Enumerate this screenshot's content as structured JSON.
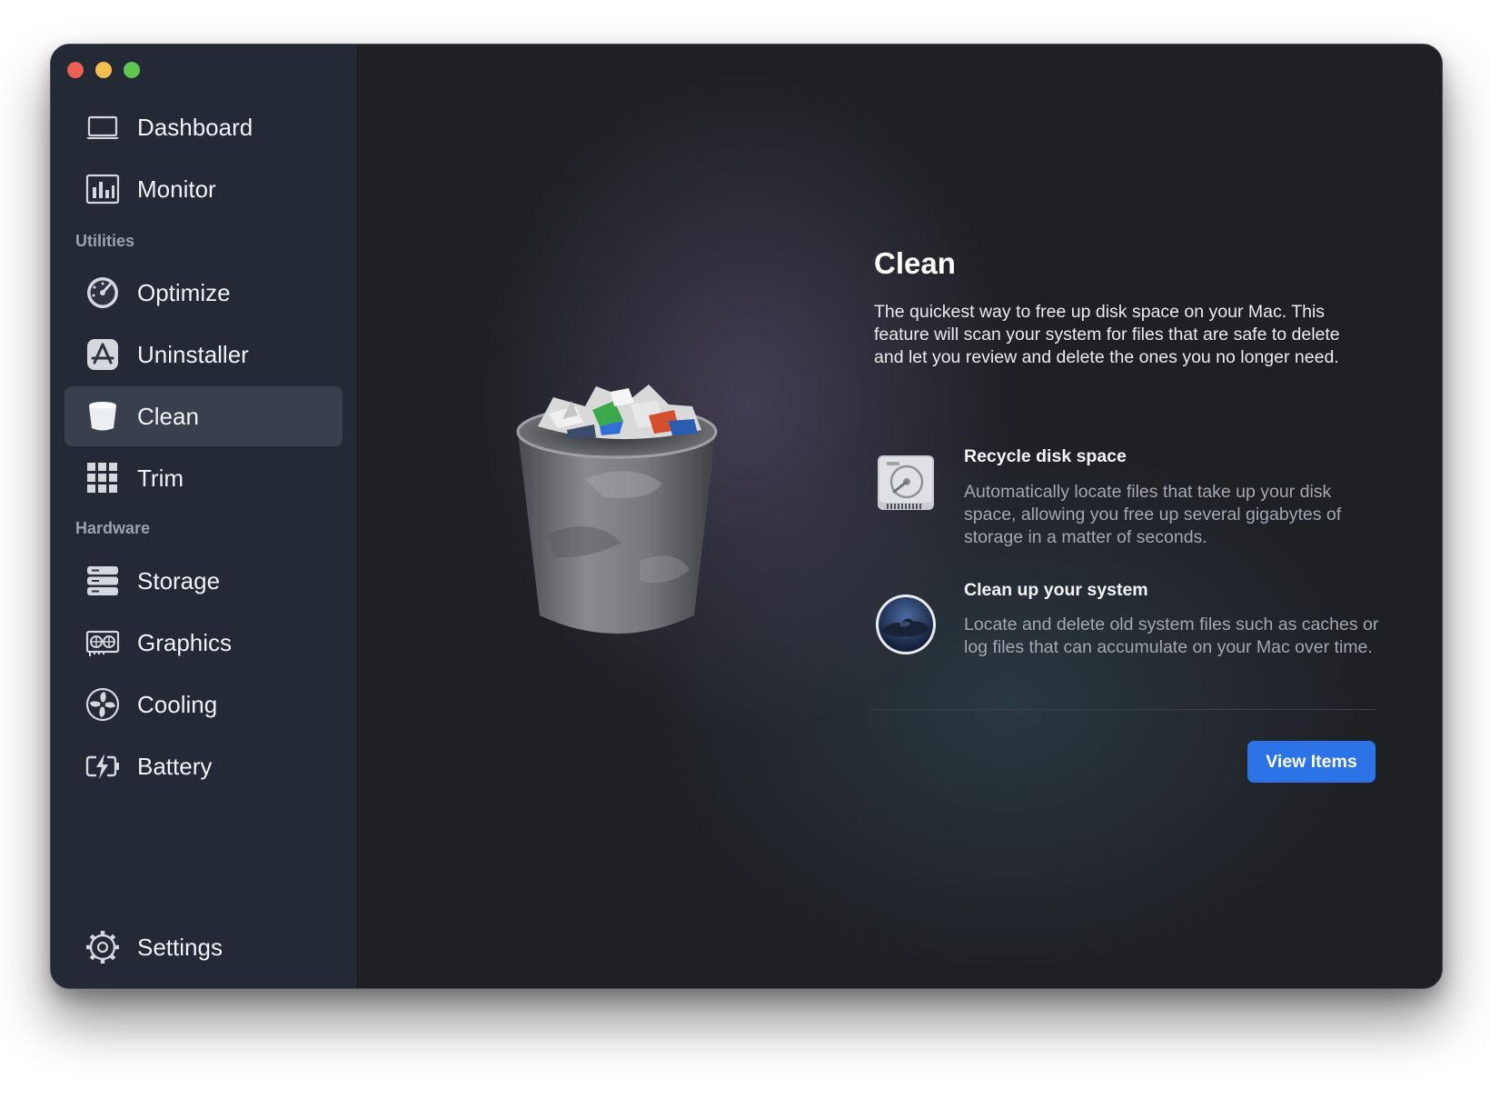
{
  "sidebar": {
    "top_items": [
      {
        "label": "Dashboard",
        "icon": "laptop-icon"
      },
      {
        "label": "Monitor",
        "icon": "bar-chart-icon"
      }
    ],
    "sections": [
      {
        "title": "Utilities",
        "items": [
          {
            "label": "Optimize",
            "icon": "speedometer-icon"
          },
          {
            "label": "Uninstaller",
            "icon": "app-store-icon"
          },
          {
            "label": "Clean",
            "icon": "cup-icon",
            "active": true
          },
          {
            "label": "Trim",
            "icon": "grid-icon"
          }
        ]
      },
      {
        "title": "Hardware",
        "items": [
          {
            "label": "Storage",
            "icon": "storage-icon"
          },
          {
            "label": "Graphics",
            "icon": "graphics-card-icon"
          },
          {
            "label": "Cooling",
            "icon": "fan-icon"
          },
          {
            "label": "Battery",
            "icon": "battery-icon"
          }
        ]
      }
    ],
    "settings": {
      "label": "Settings",
      "icon": "gear-icon"
    }
  },
  "main": {
    "title": "Clean",
    "description": "The quickest way to free up disk space on your Mac. This feature will scan your system for files that are safe to delete and let you review and delete the ones you no longer need.",
    "features": [
      {
        "title": "Recycle disk space",
        "description": "Automatically locate files that take up your disk space, allowing you free up several gigabytes of storage in a matter of seconds.",
        "icon": "hard-drive-icon"
      },
      {
        "title": "Clean up your system",
        "description": "Locate and delete old system files such as caches or log files that can accumulate on your Mac over time.",
        "icon": "macos-disk-icon"
      }
    ],
    "view_button": "View Items"
  },
  "colors": {
    "sidebar_bg": "#232935",
    "main_bg": "#1f2024",
    "active_item": "#38404d",
    "accent": "#2c73e8"
  }
}
